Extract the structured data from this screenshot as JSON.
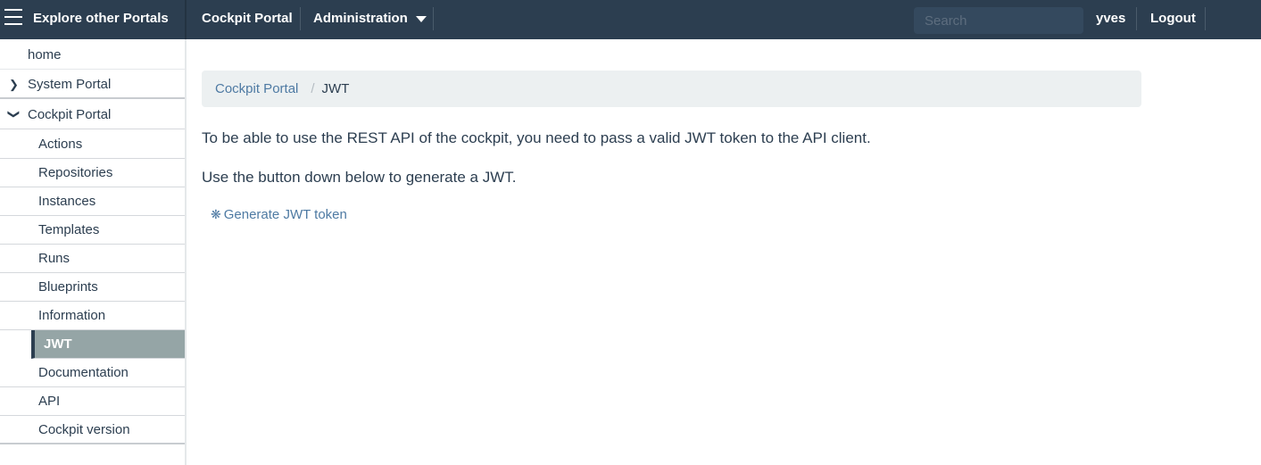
{
  "navbar": {
    "brand": "Explore other Portals",
    "links": {
      "cockpit_portal": "Cockpit Portal",
      "administration": "Administration"
    },
    "search_placeholder": "Search",
    "user": "yves",
    "logout": "Logout"
  },
  "sidebar": {
    "home": "home",
    "system_portal": "System Portal",
    "cockpit_portal": "Cockpit Portal",
    "items": [
      "Actions",
      "Repositories",
      "Instances",
      "Templates",
      "Runs",
      "Blueprints",
      "Information",
      "JWT",
      "Documentation",
      "API",
      "Cockpit version"
    ],
    "active_item": "JWT"
  },
  "breadcrumb": {
    "parent": "Cockpit Portal",
    "separator": "/",
    "current": "JWT"
  },
  "main": {
    "paragraph1": "To be able to use the REST API of the cockpit, you need to pass a valid JWT token to the API client.",
    "paragraph2": "Use the button down below to generate a JWT.",
    "generate_button": "Generate JWT token"
  },
  "colors": {
    "navbar_bg": "#2c3e50",
    "breadcrumb_bg": "#ecf0f1",
    "link": "#4e7aa3",
    "active_item_bg": "#95a5a6"
  }
}
